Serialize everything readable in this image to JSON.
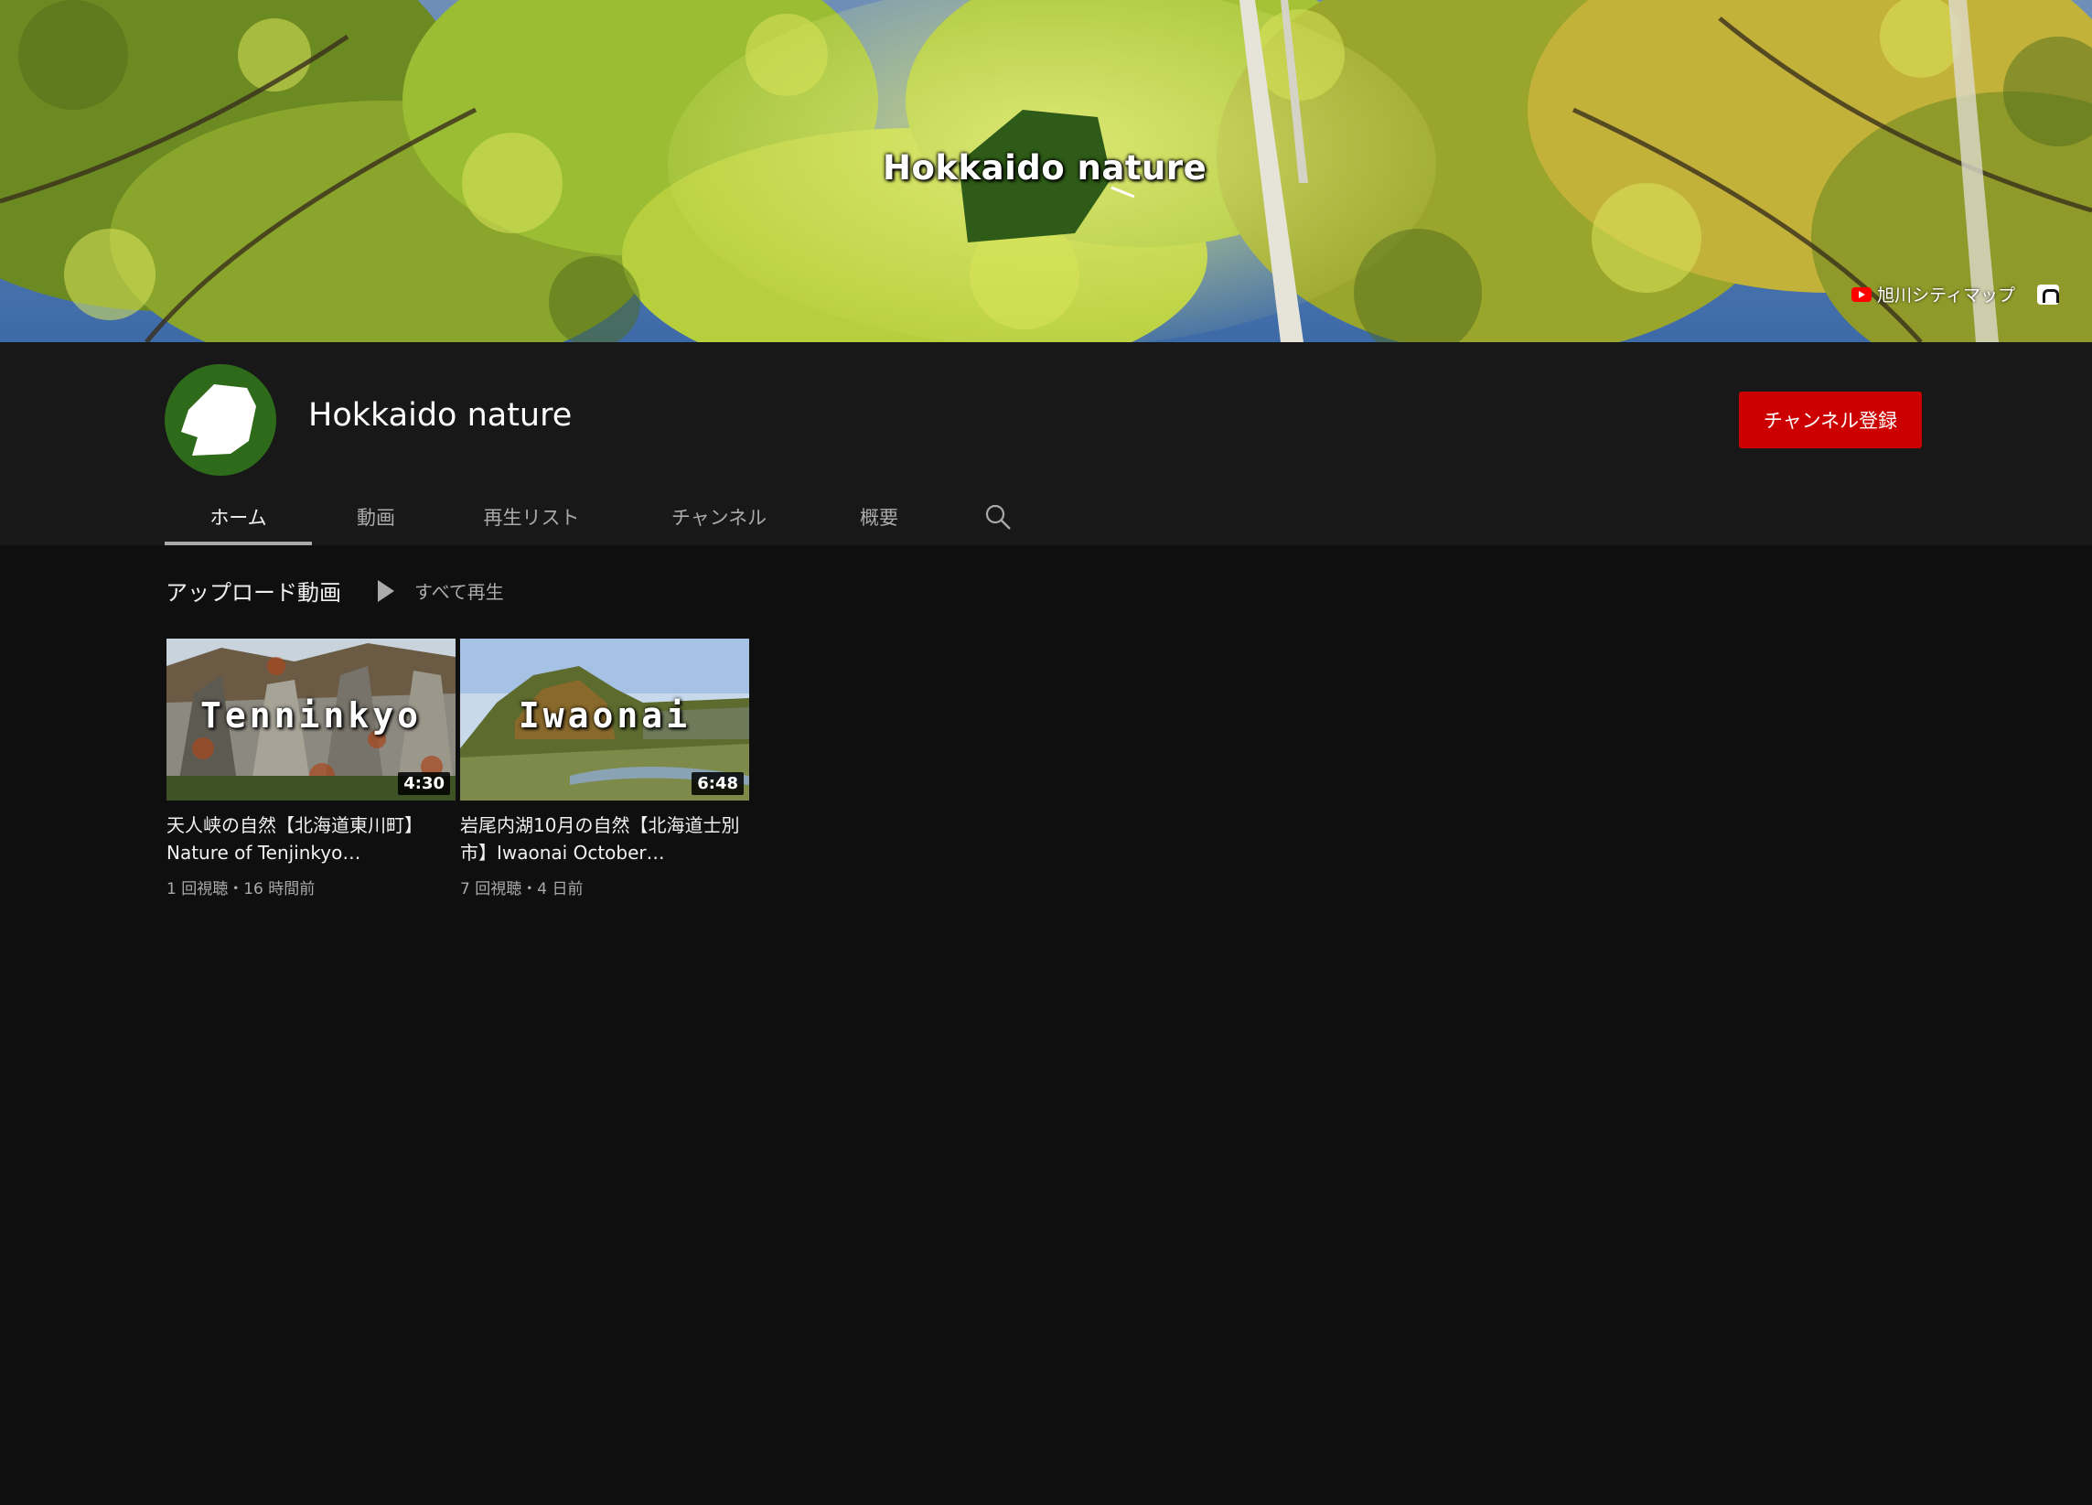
{
  "banner": {
    "title": "Hokkaido nature",
    "link_label": "旭川シティマップ",
    "link_icon": "youtube-icon",
    "social_icon": "app-icon"
  },
  "channel": {
    "name": "Hokkaido nature",
    "subscribe_label": "チャンネル登録",
    "avatar_icon": "hokkaido-map-icon"
  },
  "tabs": [
    {
      "label": "ホーム",
      "active": true
    },
    {
      "label": "動画",
      "active": false
    },
    {
      "label": "再生リスト",
      "active": false
    },
    {
      "label": "チャンネル",
      "active": false
    },
    {
      "label": "概要",
      "active": false
    }
  ],
  "search_icon": "search-icon",
  "section": {
    "title": "アップロード動画",
    "play_all_label": "すべて再生",
    "play_all_icon": "play-icon"
  },
  "videos": [
    {
      "thumb_text": "Tenninkyo",
      "duration": "4:30",
      "title": "天人峡の自然【北海道東川町】Nature of Tenjinkyo…",
      "meta": "1 回視聴・16 時間前"
    },
    {
      "thumb_text": "Iwaonai",
      "duration": "6:48",
      "title": "岩尾内湖10月の自然【北海道士別市】Iwaonai October…",
      "meta": "7 回視聴・4 日前"
    }
  ],
  "colors": {
    "background": "#0f0f0f",
    "header": "#181818",
    "subscribe": "#cc0000",
    "avatar": "#2d6b1a"
  }
}
